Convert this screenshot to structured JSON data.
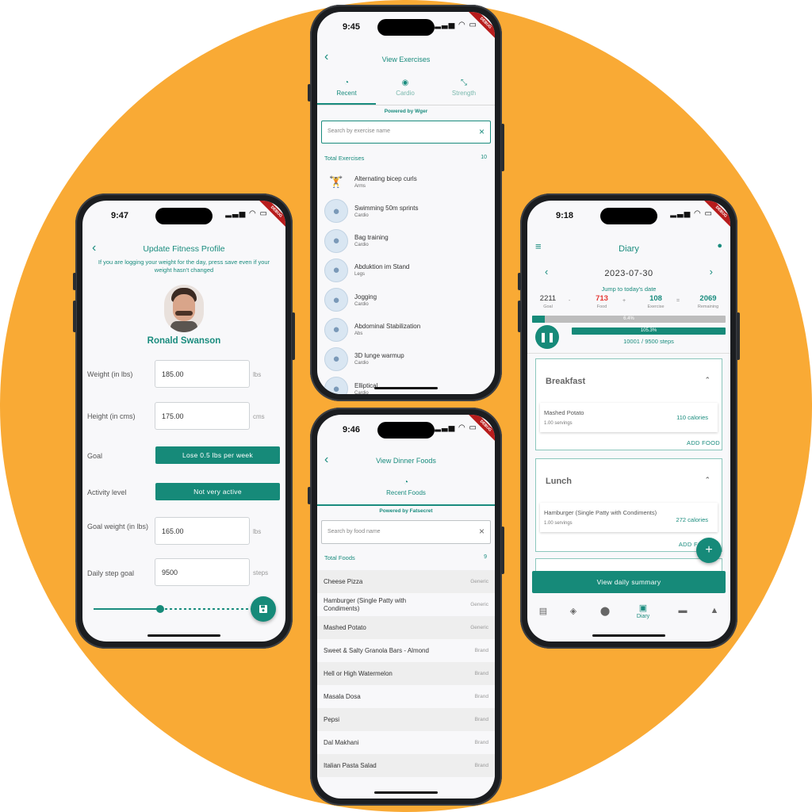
{
  "profile": {
    "time": "9:47",
    "title": "Update Fitness Profile",
    "info": "If you are logging your weight for the day, press save even if your weight hasn't changed",
    "name": "Ronald Swanson",
    "weight_label": "Weight (in lbs)",
    "weight_value": "185.00",
    "weight_unit": "lbs",
    "height_label": "Height (in cms)",
    "height_value": "175.00",
    "height_unit": "cms",
    "goal_label": "Goal",
    "goal_value": "Lose 0.5 lbs per week",
    "activity_label": "Activity level",
    "activity_value": "Not very active",
    "goal_weight_label": "Goal weight (in lbs)",
    "goal_weight_value": "165.00",
    "goal_weight_unit": "lbs",
    "step_label": "Daily step goal",
    "step_value": "9500",
    "step_unit": "steps",
    "slider_level": 0.42
  },
  "exercises": {
    "time": "9:45",
    "title": "View Exercises",
    "tabs": [
      "Recent",
      "Cardio",
      "Strength"
    ],
    "powered": "Powered by Wger",
    "search_placeholder": "Search by exercise name",
    "total_label": "Total Exercises",
    "total_count": "10",
    "items": [
      {
        "name": "Alternating bicep curls",
        "cat": "Arms"
      },
      {
        "name": "Swimming 50m sprints",
        "cat": "Cardio"
      },
      {
        "name": "Bag training",
        "cat": "Cardio"
      },
      {
        "name": "Abduktion im Stand",
        "cat": "Legs"
      },
      {
        "name": "Jogging",
        "cat": "Cardio"
      },
      {
        "name": "Abdominal Stabilization",
        "cat": "Abs"
      },
      {
        "name": "3D lunge warmup",
        "cat": "Cardio"
      },
      {
        "name": "Elliptical",
        "cat": "Cardio"
      }
    ]
  },
  "foods": {
    "time": "9:46",
    "title": "View Dinner Foods",
    "tab": "Recent Foods",
    "powered": "Powered by Fatsecret",
    "search_placeholder": "Search by food name",
    "total_label": "Total Foods",
    "total_count": "9",
    "items": [
      {
        "name": "Cheese Pizza",
        "type": "Generic"
      },
      {
        "name": "Hamburger (Single Patty with Condiments)",
        "type": "Generic"
      },
      {
        "name": "Mashed Potato",
        "type": "Generic"
      },
      {
        "name": "Sweet & Salty Granola Bars - Almond",
        "type": "Brand"
      },
      {
        "name": "Hell or High Watermelon",
        "type": "Brand"
      },
      {
        "name": "Masala Dosa",
        "type": "Brand"
      },
      {
        "name": "Pepsi",
        "type": "Brand"
      },
      {
        "name": "Dal Makhani",
        "type": "Brand"
      },
      {
        "name": "Italian Pasta Salad",
        "type": "Brand"
      }
    ]
  },
  "diary": {
    "time": "9:18",
    "title": "Diary",
    "date": "2023-07-30",
    "jump": "Jump to today's date",
    "goal_val": "2211",
    "goal_lbl": "Goal",
    "minus": "-",
    "food_val": "713",
    "food_lbl": "Food",
    "plus": "+",
    "exercise_val": "108",
    "exercise_lbl": "Exercise",
    "equals": "=",
    "remaining_val": "2069",
    "remaining_lbl": "Remaining",
    "calorie_pct": "6.4%",
    "calorie_fraction": 0.064,
    "step_pct": "105.3%",
    "steps_text": "10001 / 9500 steps",
    "breakfast": "Breakfast",
    "breakfast_food": "Mashed Potato",
    "breakfast_servings": "1.00 servings",
    "breakfast_cal": "110 calories",
    "add_food": "ADD FOOD",
    "lunch": "Lunch",
    "lunch_food": "Hamburger (Single Patty with Condiments)",
    "lunch_servings": "1.00 servings",
    "lunch_cal": "272 calories",
    "add_food_2": "ADD FO",
    "summary_btn": "View daily summary",
    "nav_active": "Diary"
  },
  "colors": {
    "background": "#F9AA35",
    "accent": "#168a79",
    "food_red": "#e53935"
  }
}
